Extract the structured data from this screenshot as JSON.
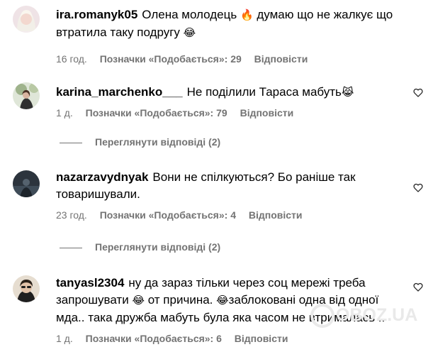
{
  "comments": [
    {
      "username": "ira.romanyk05",
      "text_a": "Олена молодець",
      "emoji_a": "🔥",
      "text_b": "думаю що не жалкує що втратила таку подругу",
      "emoji_b": "😂",
      "time": "16 год.",
      "likes": "Позначки «Подобається»: 29",
      "reply": "Відповісти",
      "avatar_color": "#e8d9dc",
      "avatar_icon": "user-photo"
    },
    {
      "username": "karina_marchenko___",
      "text_a": "Не поділили Тараса мабуть",
      "emoji_a": "😹",
      "time": "1 д.",
      "likes": "Позначки «Подобається»: 79",
      "reply": "Відповісти",
      "view_replies": "Переглянути відповіді (2)",
      "avatar_color": "#b8c4b0",
      "avatar_icon": "user-photo",
      "heart_icon": "heart-outline-icon"
    },
    {
      "username": "nazarzavydnyak",
      "text_a": "Вони не спілкуються? Бо раніше так товаришували.",
      "time": "23 год.",
      "likes": "Позначки «Подобається»: 4",
      "reply": "Відповісти",
      "view_replies": "Переглянути відповіді (2)",
      "avatar_color": "#3e4a56",
      "avatar_icon": "user-photo",
      "heart_icon": "heart-outline-icon"
    },
    {
      "username": "tanyasl2304",
      "text_a": "ну да зараз тільки через соц мережі треба запрошувати",
      "emoji_a": "😂",
      "text_b": "от причина.",
      "emoji_b": "😂",
      "text_c": "заблоковані одна від одної мда.. така дружба мабуть була яка часом не втрималась ..",
      "time": "1 д.",
      "likes": "Позначки «Подобається»: 6",
      "reply": "Відповісти",
      "avatar_color": "#d9cfc2",
      "avatar_icon": "user-photo",
      "heart_icon": "heart-outline-icon"
    }
  ],
  "watermark": "OBOZ.UA"
}
